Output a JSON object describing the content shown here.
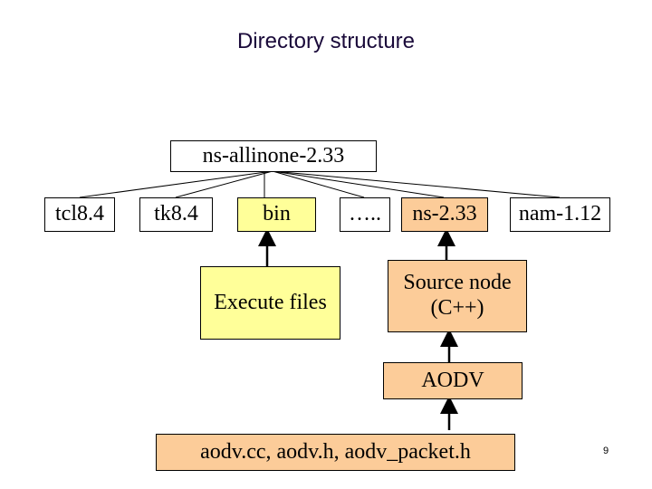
{
  "title": "Directory structure",
  "root": {
    "label": "ns-allinone-2.33"
  },
  "children": [
    {
      "label": "tcl8.4",
      "color": "#ffffff"
    },
    {
      "label": "tk8.4",
      "color": "#ffffff"
    },
    {
      "label": "bin",
      "color": "#ffff99"
    },
    {
      "label": "…..",
      "color": "#ffffff"
    },
    {
      "label": "ns-2.33",
      "color": "#fccc99"
    },
    {
      "label": "nam-1.12",
      "color": "#ffffff"
    }
  ],
  "sub_nodes": {
    "execute_files": {
      "label": "Execute files",
      "parent": "bin"
    },
    "source_node": {
      "line1": "Source node",
      "line2": "(C++)",
      "parent": "ns-2.33"
    },
    "aodv": {
      "label": "AODV",
      "parent": "Source node (C++)"
    },
    "aodv_files": {
      "label": "aodv.cc, aodv.h, aodv_packet.h",
      "parent": "AODV"
    }
  },
  "page_number": "9"
}
